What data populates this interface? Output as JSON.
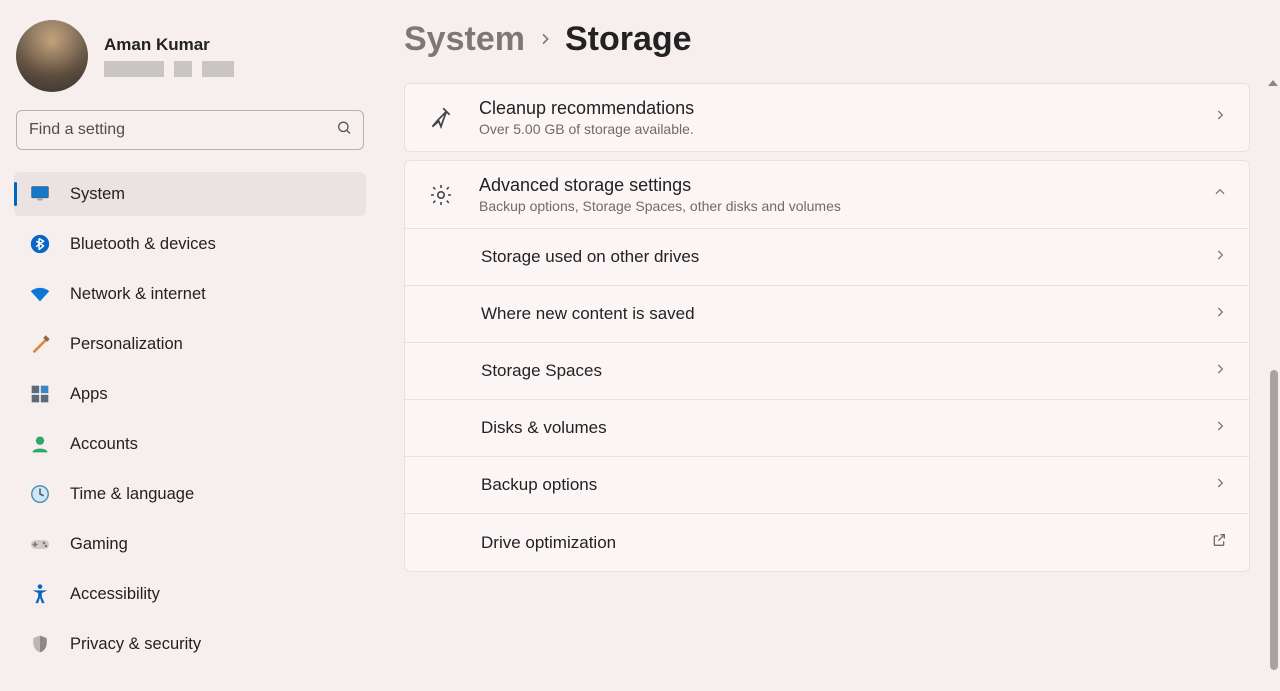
{
  "profile": {
    "name": "Aman Kumar"
  },
  "search": {
    "placeholder": "Find a setting"
  },
  "nav": {
    "items": [
      {
        "label": "System"
      },
      {
        "label": "Bluetooth & devices"
      },
      {
        "label": "Network & internet"
      },
      {
        "label": "Personalization"
      },
      {
        "label": "Apps"
      },
      {
        "label": "Accounts"
      },
      {
        "label": "Time & language"
      },
      {
        "label": "Gaming"
      },
      {
        "label": "Accessibility"
      },
      {
        "label": "Privacy & security"
      }
    ]
  },
  "breadcrumb": {
    "parent": "System",
    "current": "Storage"
  },
  "cleanup": {
    "title": "Cleanup recommendations",
    "sub": "Over 5.00 GB of storage available."
  },
  "advanced": {
    "title": "Advanced storage settings",
    "sub": "Backup options, Storage Spaces, other disks and volumes",
    "items": [
      {
        "label": "Storage used on other drives"
      },
      {
        "label": "Where new content is saved"
      },
      {
        "label": "Storage Spaces"
      },
      {
        "label": "Disks & volumes"
      },
      {
        "label": "Backup options"
      },
      {
        "label": "Drive optimization"
      }
    ]
  }
}
